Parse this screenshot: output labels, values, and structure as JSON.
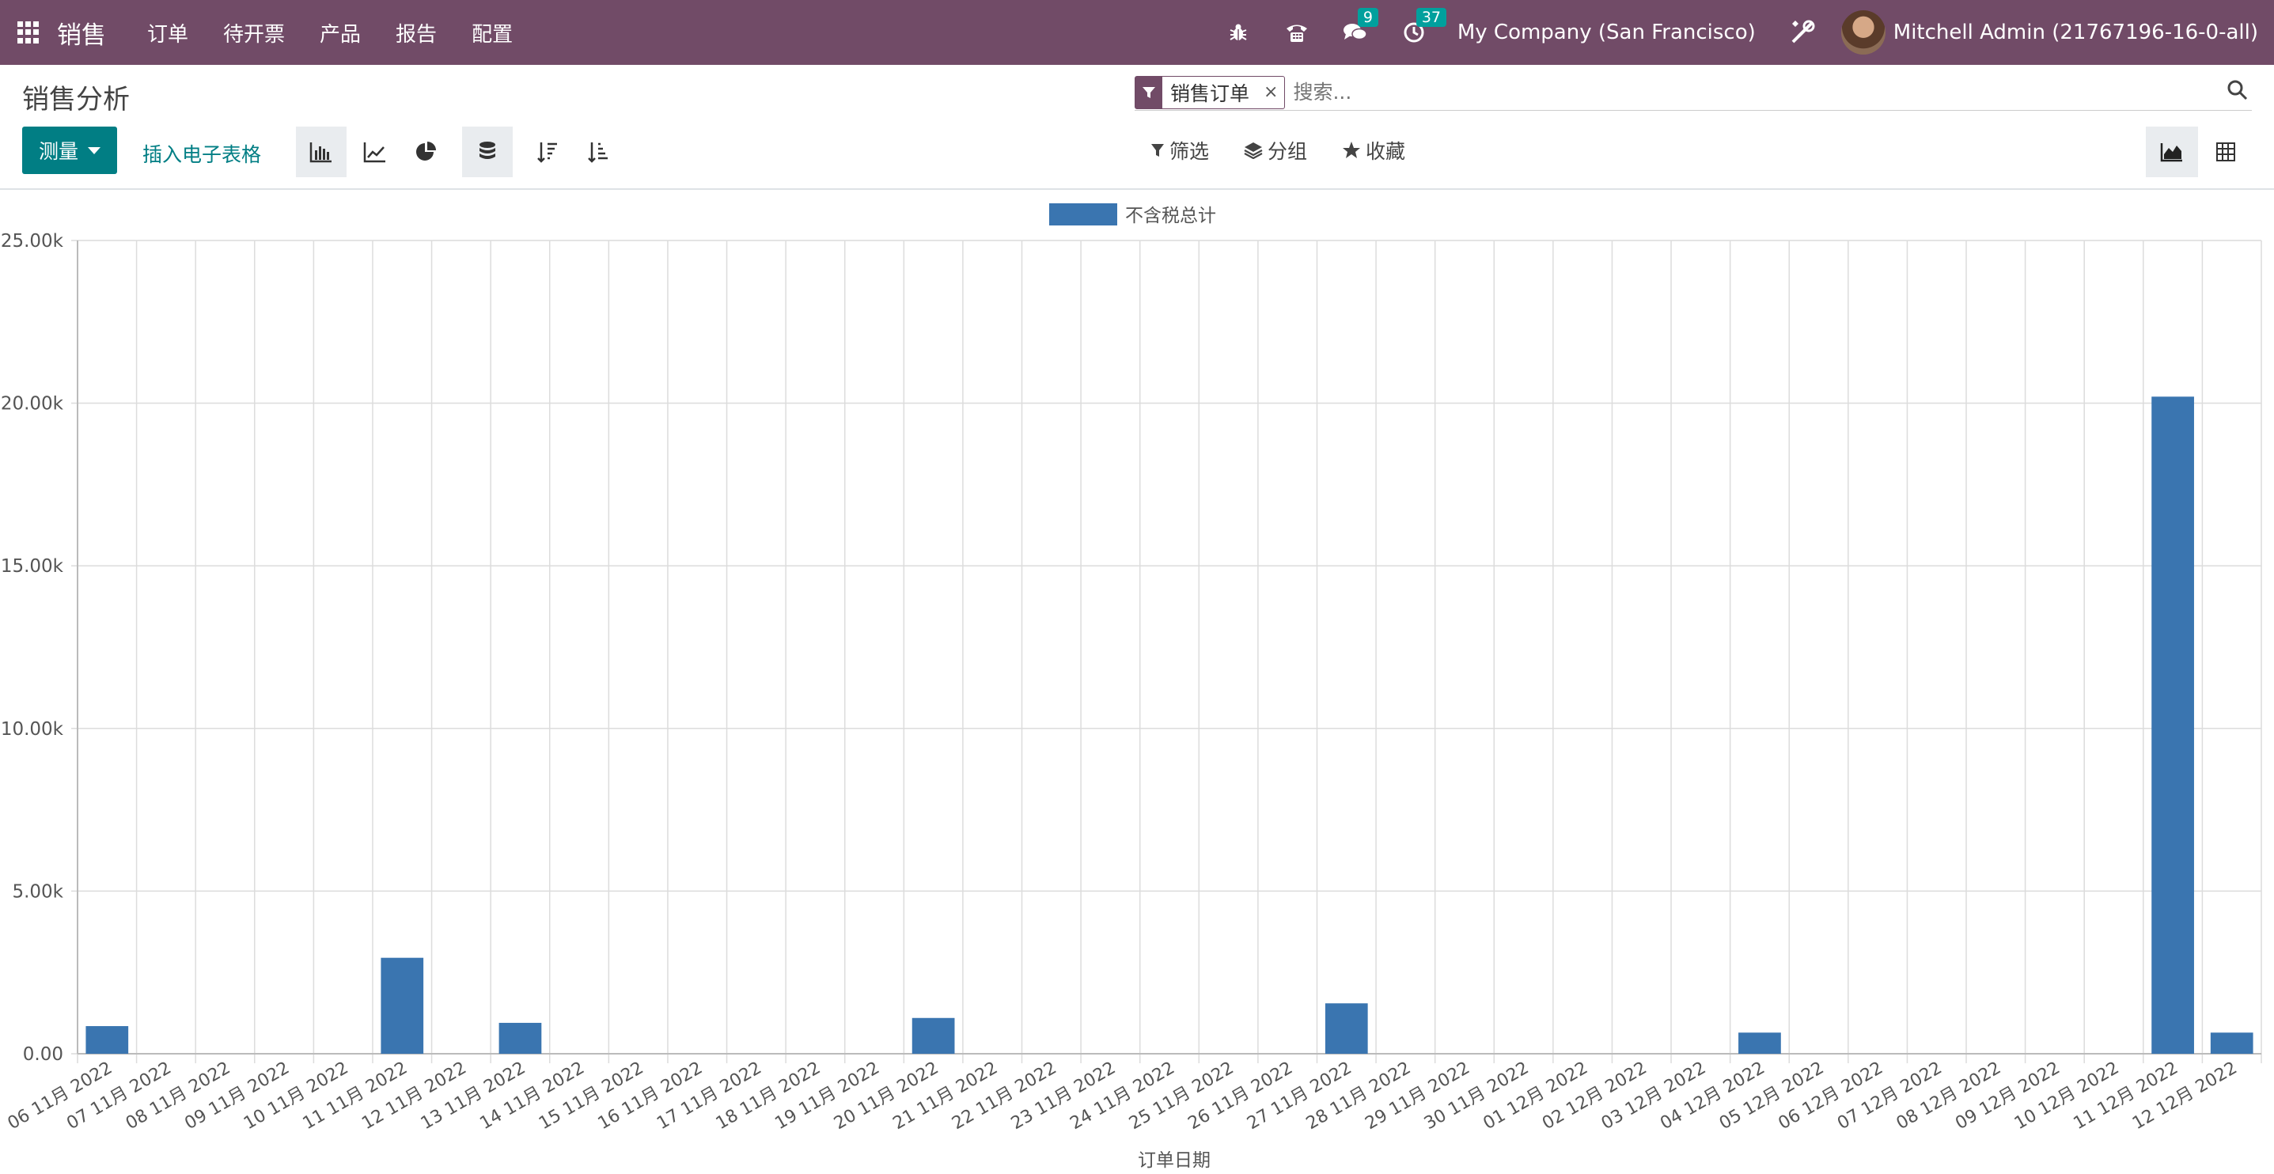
{
  "navbar": {
    "app_name": "销售",
    "menu": [
      "订单",
      "待开票",
      "产品",
      "报告",
      "配置"
    ],
    "messages_count": "9",
    "activities_count": "37",
    "company": "My Company (San Francisco)",
    "user": "Mitchell Admin (21767196-16-0-all)"
  },
  "control_panel": {
    "title": "销售分析",
    "facet": "销售订单",
    "facet_remove": "×",
    "search_placeholder": "搜索...",
    "measure_label": "测量",
    "insert_spreadsheet": "插入电子表格",
    "filter_label": "筛选",
    "group_label": "分组",
    "favorites_label": "收藏"
  },
  "colors": {
    "brand": "#714b67",
    "accent": "#017e84",
    "bar": "#3a75b0",
    "badge": "#00a09d"
  },
  "chart_data": {
    "type": "bar",
    "legend": [
      "不含税总计"
    ],
    "xlabel": "订单日期",
    "ylim": [
      0,
      25000
    ],
    "yticks": [
      "0.00",
      "5.00k",
      "10.00k",
      "15.00k",
      "20.00k",
      "25.00k"
    ],
    "categories": [
      "06 11月 2022",
      "07 11月 2022",
      "08 11月 2022",
      "09 11月 2022",
      "10 11月 2022",
      "11 11月 2022",
      "12 11月 2022",
      "13 11月 2022",
      "14 11月 2022",
      "15 11月 2022",
      "16 11月 2022",
      "17 11月 2022",
      "18 11月 2022",
      "19 11月 2022",
      "20 11月 2022",
      "21 11月 2022",
      "22 11月 2022",
      "23 11月 2022",
      "24 11月 2022",
      "25 11月 2022",
      "26 11月 2022",
      "27 11月 2022",
      "28 11月 2022",
      "29 11月 2022",
      "30 11月 2022",
      "01 12月 2022",
      "02 12月 2022",
      "03 12月 2022",
      "04 12月 2022",
      "05 12月 2022",
      "06 12月 2022",
      "07 12月 2022",
      "08 12月 2022",
      "09 12月 2022",
      "10 12月 2022",
      "11 12月 2022",
      "12 12月 2022"
    ],
    "series": [
      {
        "name": "不含税总计",
        "values": [
          850,
          0,
          0,
          0,
          0,
          2950,
          0,
          950,
          0,
          0,
          0,
          0,
          0,
          0,
          1100,
          0,
          0,
          0,
          0,
          0,
          0,
          1550,
          0,
          0,
          0,
          0,
          0,
          0,
          650,
          0,
          0,
          0,
          0,
          0,
          0,
          20200,
          650
        ]
      }
    ]
  }
}
